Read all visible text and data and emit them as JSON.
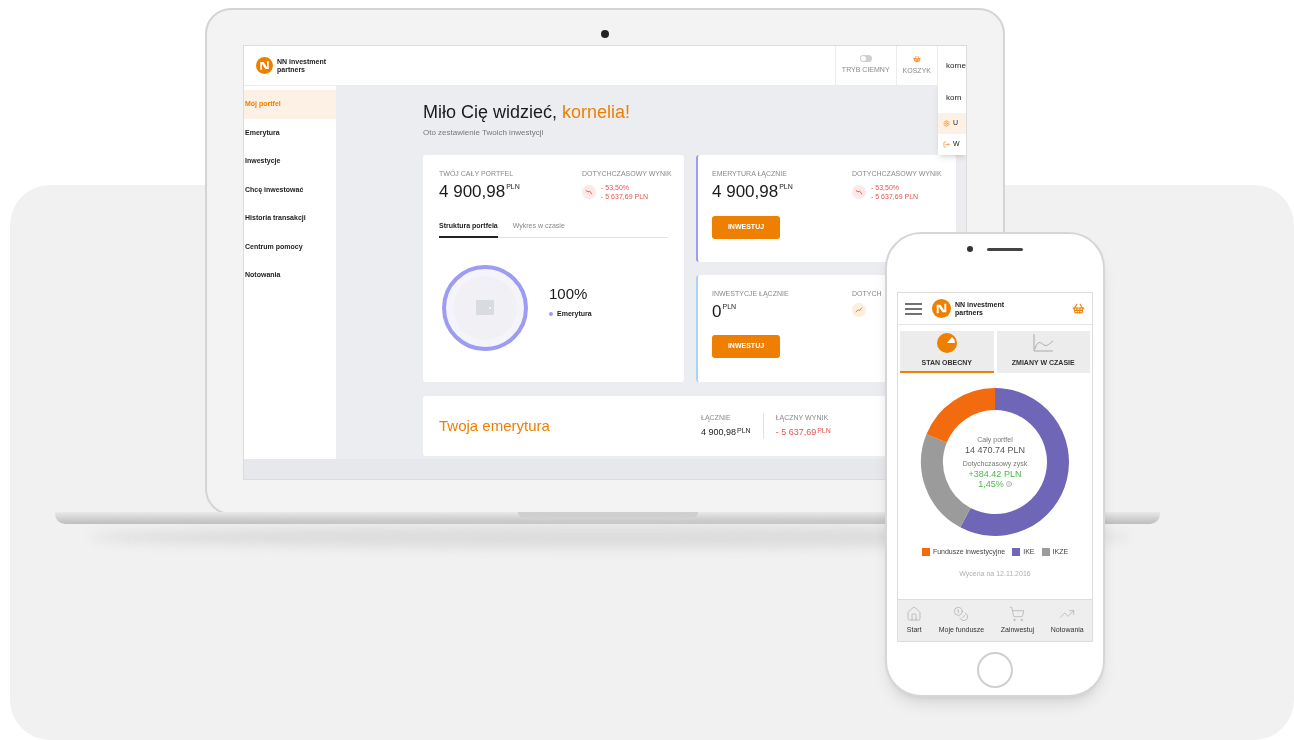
{
  "laptop_app": {
    "header": {
      "logo_lines": [
        "NN investment",
        "partners"
      ],
      "dark_mode": {
        "label": "TRYB CIEMNY",
        "on": false
      },
      "cart": {
        "label": "KOSZYK"
      },
      "user": "korne"
    },
    "user_menu": {
      "name": "korn",
      "items": [
        {
          "label": "U",
          "kind": "settings",
          "selected": true
        },
        {
          "label": "W",
          "kind": "logout",
          "selected": false
        }
      ]
    },
    "sidebar": {
      "items": [
        {
          "label": "Mój portfel",
          "selected": true
        },
        {
          "label": "Emerytura",
          "selected": false
        },
        {
          "label": "Inwestycje",
          "selected": false
        },
        {
          "label": "Chcę inwestować",
          "selected": false
        },
        {
          "label": "Historia transakcji",
          "selected": false
        },
        {
          "label": "Centrum pomocy",
          "selected": false
        },
        {
          "label": "Notowania",
          "selected": false
        }
      ]
    },
    "greeting_prefix": "Miło Cię widzieć,",
    "greeting_name": "kornelia!",
    "subtitle": "Oto zestawienie Twoich inwestycji",
    "portfolio_card": {
      "label": "TWÓJ CAŁY PORTFEL",
      "amount": "4 900,98",
      "currency": "PLN",
      "result_label": "DOTYCHCZASOWY WYNIK",
      "negative": true,
      "result_percent": "- 53,50%",
      "result_amount": "- 5 637,69 PLN",
      "tabs": [
        {
          "label": "Struktura portfela",
          "selected": true
        },
        {
          "label": "Wykres w czasie",
          "selected": false
        }
      ],
      "share": "100%",
      "legend": [
        {
          "label": "Emerytura",
          "color": "#9d9cf2"
        }
      ]
    },
    "summary_cards": [
      {
        "label": "EMERYTURA ŁĄCZNIE",
        "amount": "4 900,98",
        "currency": "PLN",
        "color": "#9d9cf2",
        "result_label": "DOTYCHCZASOWY WYNIK",
        "negative": true,
        "result_percent": "- 53,50%",
        "result_amount": "- 5 637,69 PLN",
        "button": "INWESTUJ"
      },
      {
        "label": "INWESTYCJE ŁĄCZNIE",
        "amount": "0",
        "currency": "PLN",
        "color": "#a9d4f5",
        "result_label": "DOTYCH",
        "negative": false,
        "button": "INWESTUJ"
      }
    ],
    "retirement": {
      "title": "Twoja emerytura",
      "total_label": "ŁĄCZNIE",
      "total": "4 900,98",
      "total_currency": "PLN",
      "result_label": "ŁĄCZNY WYNIK",
      "result": "- 5 637,69",
      "result_currency": "PLN"
    }
  },
  "mobile_app": {
    "logo_lines": [
      "NN investment",
      "partners"
    ],
    "tabs": [
      {
        "label": "STAN OBECNY",
        "kind": "pie",
        "selected": true
      },
      {
        "label": "ZMIANY W CZASIE",
        "kind": "line",
        "selected": false
      }
    ],
    "donut": {
      "title": "Cały portfel",
      "total": "14 470.74 PLN",
      "gain_label": "Dotychczasowy zysk",
      "gain": "+384.42 PLN",
      "gain_percent": "1,45%"
    },
    "legend": [
      {
        "label": "Fundusze inwestycyjne",
        "color": "#f26b0f"
      },
      {
        "label": "IKE",
        "color": "#6f66b8"
      },
      {
        "label": "IKZE",
        "color": "#9b9b9b"
      }
    ],
    "valuation": "Wycena na 12.11.2016",
    "nav": [
      {
        "label": "Start",
        "kind": "home"
      },
      {
        "label": "Moje fundusze",
        "kind": "coins"
      },
      {
        "label": "Zainwestuj",
        "kind": "cart"
      },
      {
        "label": "Notowania",
        "kind": "chart"
      }
    ]
  }
}
